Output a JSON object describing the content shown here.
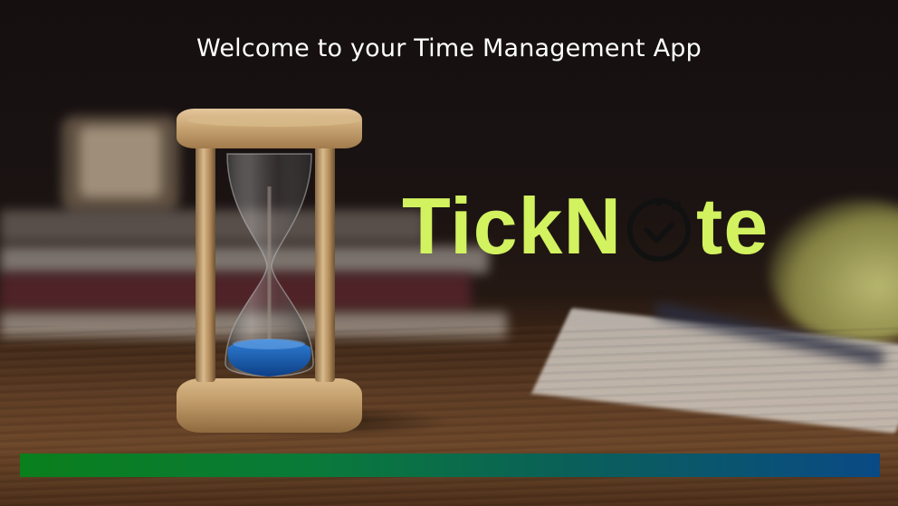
{
  "app": {
    "welcome_text": "Welcome to your Time Management App",
    "logo": {
      "text_before": "TickN",
      "text_after": "te",
      "color": "#d2f25f",
      "clock_icon": "clock-check-icon"
    }
  },
  "loading_bar": {
    "progress": 1.0,
    "gradient_start": "#0a7f1c",
    "gradient_end": "#0a4a85"
  },
  "background": {
    "description_icon": "hourglass-photo"
  }
}
